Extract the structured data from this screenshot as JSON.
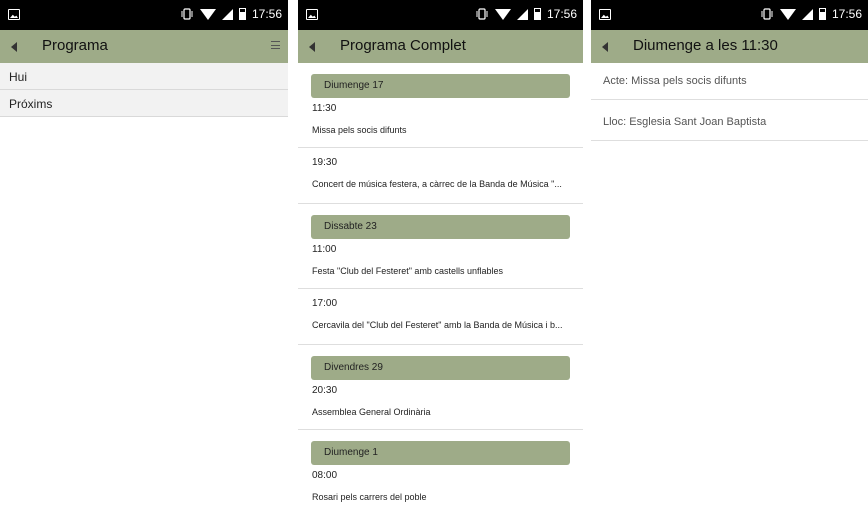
{
  "status": {
    "time": "17:56"
  },
  "screen1": {
    "title": "Programa",
    "menu": [
      "Hui",
      "Próxims"
    ]
  },
  "screen2": {
    "title": "Programa Complet",
    "days": [
      {
        "header": "Diumenge 17",
        "events": [
          {
            "time": "11:30",
            "desc": "Missa pels socis difunts"
          },
          {
            "time": "19:30",
            "desc": "Concert de música festera, a càrrec de la Banda de Música \"..."
          }
        ]
      },
      {
        "header": "Dissabte 23",
        "events": [
          {
            "time": "11:00",
            "desc": "Festa \"Club del Festeret\" amb castells unflables"
          },
          {
            "time": "17:00",
            "desc": "Cercavila del \"Club del Festeret\" amb la Banda de Música i b..."
          }
        ]
      },
      {
        "header": "Divendres 29",
        "events": [
          {
            "time": "20:30",
            "desc": "Assemblea General Ordinària"
          }
        ]
      },
      {
        "header": "Diumenge 1",
        "events": [
          {
            "time": "08:00",
            "desc": "Rosari pels carrers del poble"
          }
        ]
      }
    ]
  },
  "screen3": {
    "title": "Diumenge a les 11:30",
    "acte": "Acte: Missa pels socis difunts",
    "lloc": "Lloc: Esglesia Sant Joan Baptista"
  },
  "icons": [
    "image-icon",
    "vibrate-icon",
    "wifi-icon",
    "signal-icon",
    "battery-icon",
    "back-icon",
    "menu-icon"
  ]
}
